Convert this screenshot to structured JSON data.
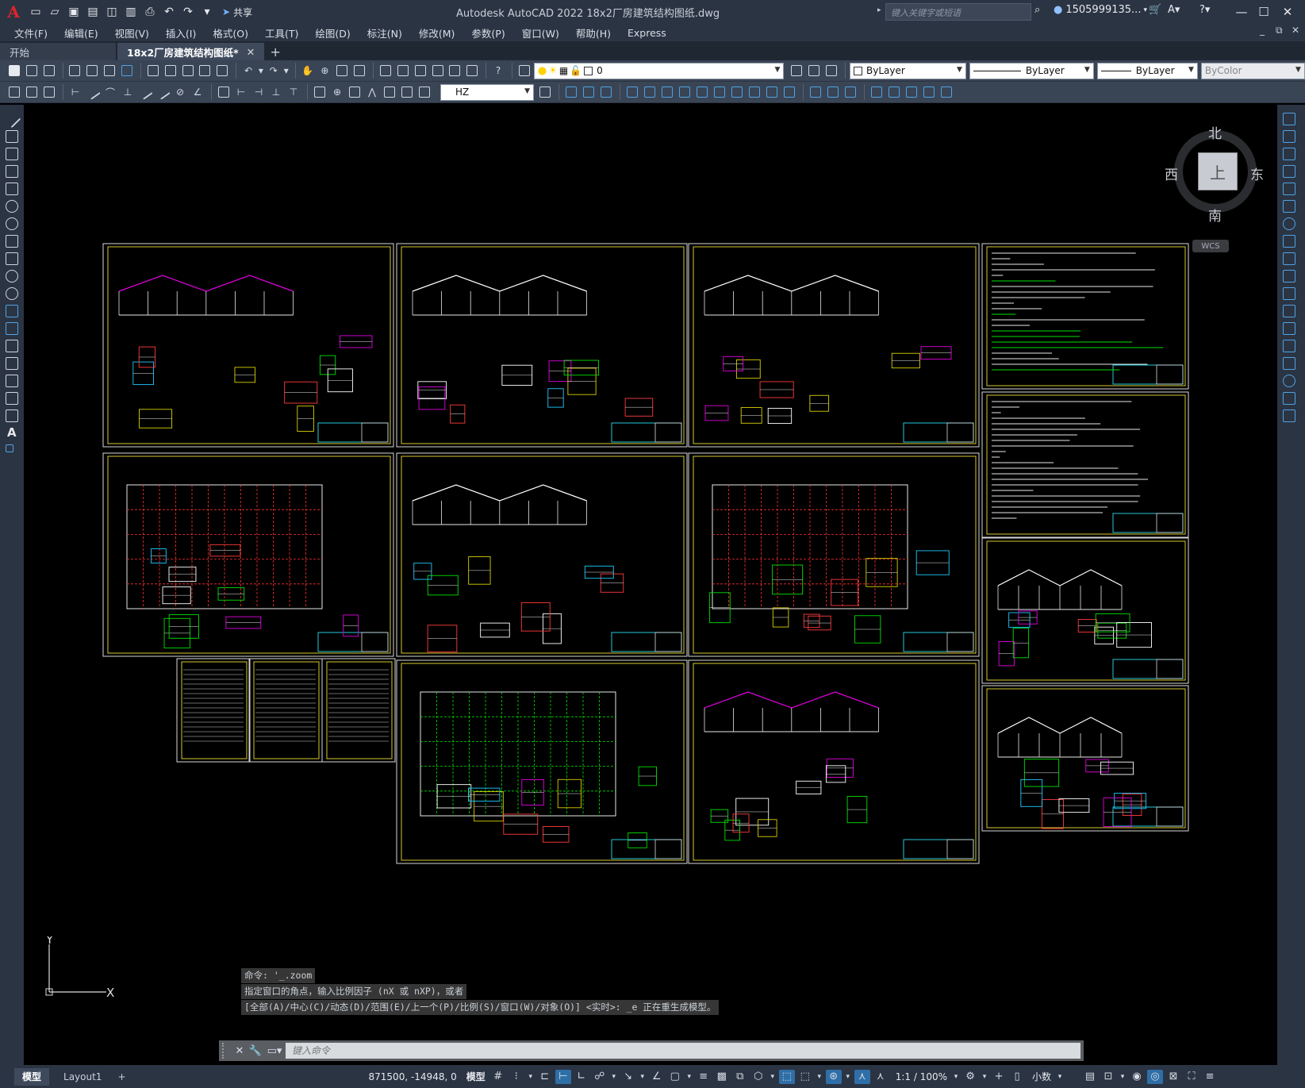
{
  "title_bar": {
    "app_title": "Autodesk AutoCAD 2022    18x2厂房建筑结构图纸.dwg",
    "share_label": "共享",
    "search_placeholder": "键入关键字或短语",
    "user_label": "1505999135...",
    "quick_access_icons": [
      "new-icon",
      "open-icon",
      "save-icon",
      "saveas-icon",
      "web-icon",
      "export-icon",
      "plot-icon",
      "undo-icon",
      "redo-icon",
      "dropdown-icon"
    ]
  },
  "menu": {
    "items": [
      "文件(F)",
      "编辑(E)",
      "视图(V)",
      "插入(I)",
      "格式(O)",
      "工具(T)",
      "绘图(D)",
      "标注(N)",
      "修改(M)",
      "参数(P)",
      "窗口(W)",
      "帮助(H)",
      "Express"
    ]
  },
  "tabs": {
    "items": [
      {
        "label": "开始"
      },
      {
        "label": "18x2厂房建筑结构图纸*"
      }
    ]
  },
  "properties": {
    "layer_value": "0",
    "color_value": "ByLayer",
    "linetype_value": "ByLayer",
    "lineweight_value": "ByLayer",
    "plotstyle_value": "ByColor",
    "dimstyle_value": "HZ"
  },
  "viewcube": {
    "north": "北",
    "south": "南",
    "east": "东",
    "west": "西",
    "face": "上",
    "wcs_label": "WCS"
  },
  "ucs": {
    "x_label": "X",
    "y_label": "Y"
  },
  "command": {
    "history": [
      "命令: '_.zoom",
      "指定窗口的角点，输入比例因子 (nX 或 nXP)，或者",
      "[全部(A)/中心(C)/动态(D)/范围(E)/上一个(P)/比例(S)/窗口(W)/对象(O)] <实时>: _e 正在重生成模型。"
    ],
    "input_placeholder": "键入命令"
  },
  "status_bar": {
    "layout_tabs": [
      "模型",
      "Layout1"
    ],
    "coordinates": "871500, -14948, 0",
    "mode_label": "模型",
    "scale_label": "1:1 / 100%",
    "units_label": "小数"
  }
}
